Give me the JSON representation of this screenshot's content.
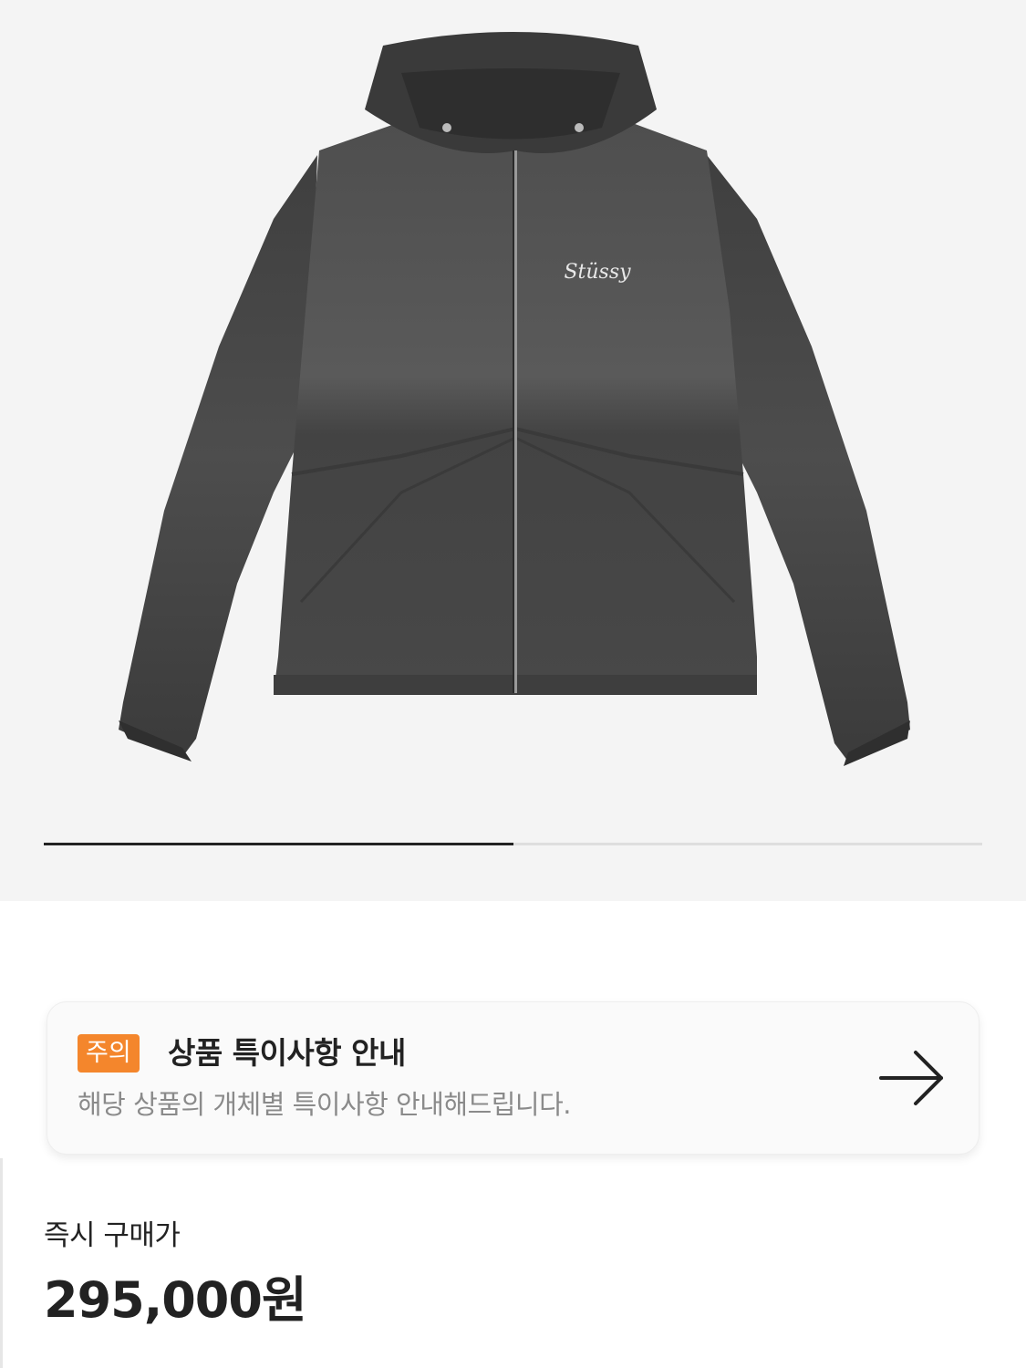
{
  "product": {
    "image_alt": "Stussy nylon hooded zip jacket, charcoal",
    "logo_text": "Stüssy",
    "gallery_progress": 0.5
  },
  "notice": {
    "badge": "주의",
    "title": "상품 특이사항 안내",
    "description": "해당 상품의 개체별 특이사항 안내해드립니다.",
    "arrow_icon": "arrow-right-icon"
  },
  "price": {
    "label": "즉시 구매가",
    "value": "295,000원"
  },
  "colors": {
    "gallery_bg": "#f4f4f4",
    "badge": "#f4862c",
    "jacket": "#4a4a4a"
  }
}
